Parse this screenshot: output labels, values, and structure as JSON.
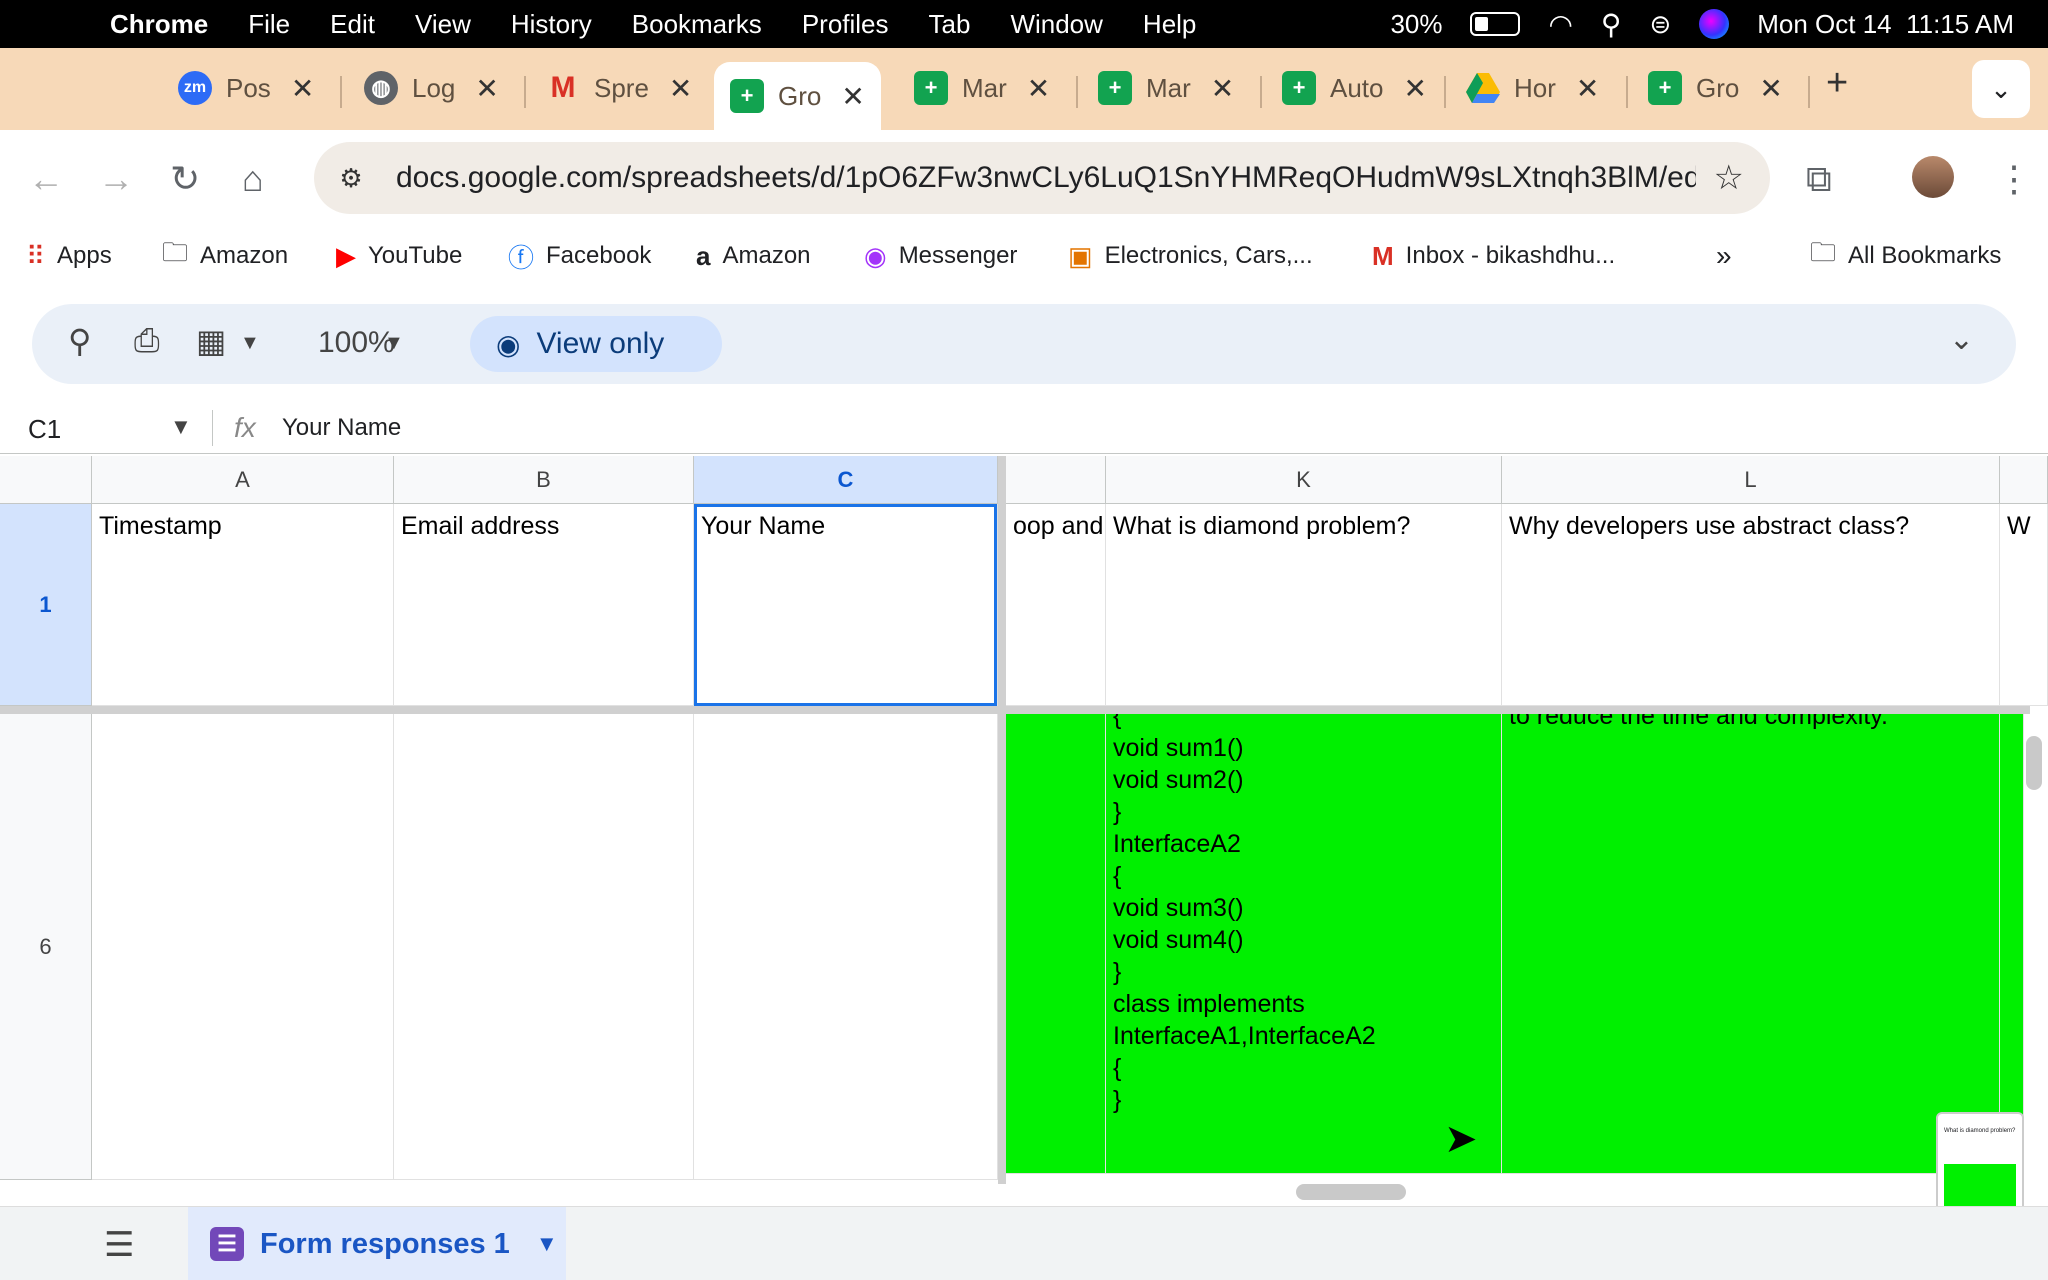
{
  "menubar": {
    "app": "Chrome",
    "items": [
      "File",
      "Edit",
      "View",
      "History",
      "Bookmarks",
      "Profiles",
      "Tab",
      "Window",
      "Help"
    ],
    "battery": "30%",
    "datetime": "Mon Oct 14  11:15 AM"
  },
  "tabs": [
    {
      "title": "Pos",
      "icon": "zoom-icon"
    },
    {
      "title": "Log",
      "icon": "globe-icon"
    },
    {
      "title": "Spre",
      "icon": "gmail-icon"
    },
    {
      "title": "Gro",
      "icon": "sheets-icon",
      "active": true
    },
    {
      "title": "Mar",
      "icon": "sheets-icon"
    },
    {
      "title": "Mar",
      "icon": "sheets-icon"
    },
    {
      "title": "Auto",
      "icon": "sheets-icon"
    },
    {
      "title": "Hor",
      "icon": "drive-icon"
    },
    {
      "title": "Gro",
      "icon": "sheets-icon"
    }
  ],
  "address": {
    "url": "docs.google.com/spreadsheets/d/1pO6ZFw3nwCLy6LuQ1SnYHMReqOHudmW9sLXtnqh3BlM/ed..."
  },
  "bookmarks": {
    "apps": "Apps",
    "amazon1": "Amazon",
    "youtube": "YouTube",
    "facebook": "Facebook",
    "amazon2": "Amazon",
    "messenger": "Messenger",
    "electronics": "Electronics, Cars,...",
    "inbox": "Inbox - bikashdhu...",
    "all": "All Bookmarks"
  },
  "toolbar": {
    "zoom": "100%",
    "view_only": "View only"
  },
  "formula": {
    "cell_ref": "C1",
    "fx": "fx",
    "value": "Your Name"
  },
  "grid": {
    "columns": {
      "a": "A",
      "b": "B",
      "c": "C",
      "k": "K",
      "l": "L"
    },
    "rows": {
      "r1": "1",
      "r6": "6"
    },
    "header_row": {
      "a": "Timestamp",
      "b": "Email address",
      "c": "Your Name",
      "j_partial": "oop and",
      "k": "What is diamond problem?",
      "l": "Why developers use abstract class?",
      "m_partial": "W"
    },
    "row6": {
      "k_lines": [
        "{",
        "void sum1()",
        "void sum2()",
        "}",
        "InterfaceA2",
        "{",
        "void sum3()",
        "void sum4()",
        "}",
        "class implements",
        "InterfaceA1,InterfaceA2",
        "{",
        "}"
      ],
      "l_partial": "to reduce the time and complexity."
    }
  },
  "thumbnail": {
    "header": "What is diamond problem?"
  },
  "sheet": {
    "tab_label": "Form responses 1"
  },
  "colors": {
    "highlight": "#00f000",
    "selection": "#1a73e8",
    "tabstrip": "#f7d9b8"
  }
}
